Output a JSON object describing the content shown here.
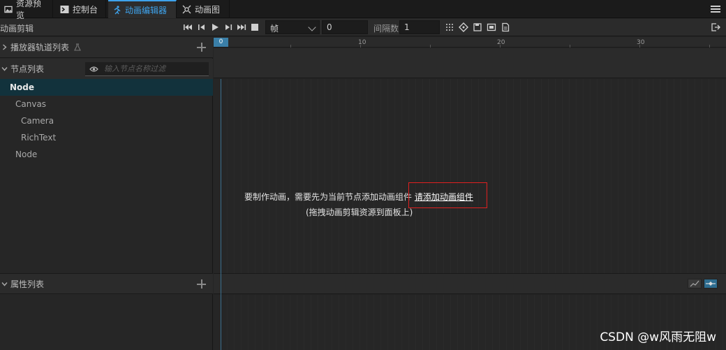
{
  "tabs": [
    {
      "label": "资源预览",
      "icon": "picture-icon"
    },
    {
      "label": "控制台",
      "icon": "terminal-icon"
    },
    {
      "label": "动画编辑器",
      "icon": "running-figure-icon"
    },
    {
      "label": "动画图",
      "icon": "graph-icon"
    }
  ],
  "toolbar": {
    "title": "动画剪辑",
    "frame_unit": "帧",
    "current_frame": "0",
    "interval_label": "间隔数",
    "interval_value": "1"
  },
  "left": {
    "player_tracks_label": "播放器轨道列表",
    "node_list_label": "节点列表",
    "filter_placeholder": "输入节点名称过滤",
    "nodes": [
      "Node",
      "Canvas",
      "Camera",
      "RichText",
      "Node"
    ],
    "property_list_label": "属性列表"
  },
  "timeline": {
    "cursor": "0",
    "ticks": [
      "10",
      "20",
      "30"
    ]
  },
  "hint": {
    "line1": "要制作动画，需要先为当前节点添加动画组件",
    "link": "请添加动画组件",
    "line2": "(拖拽动画剪辑资源到面板上)"
  },
  "watermark": "CSDN @w风雨无阻w",
  "colors": {
    "accent": "#3ea3ec",
    "selected_row": "#12323c",
    "highlight_box": "#e02020"
  }
}
